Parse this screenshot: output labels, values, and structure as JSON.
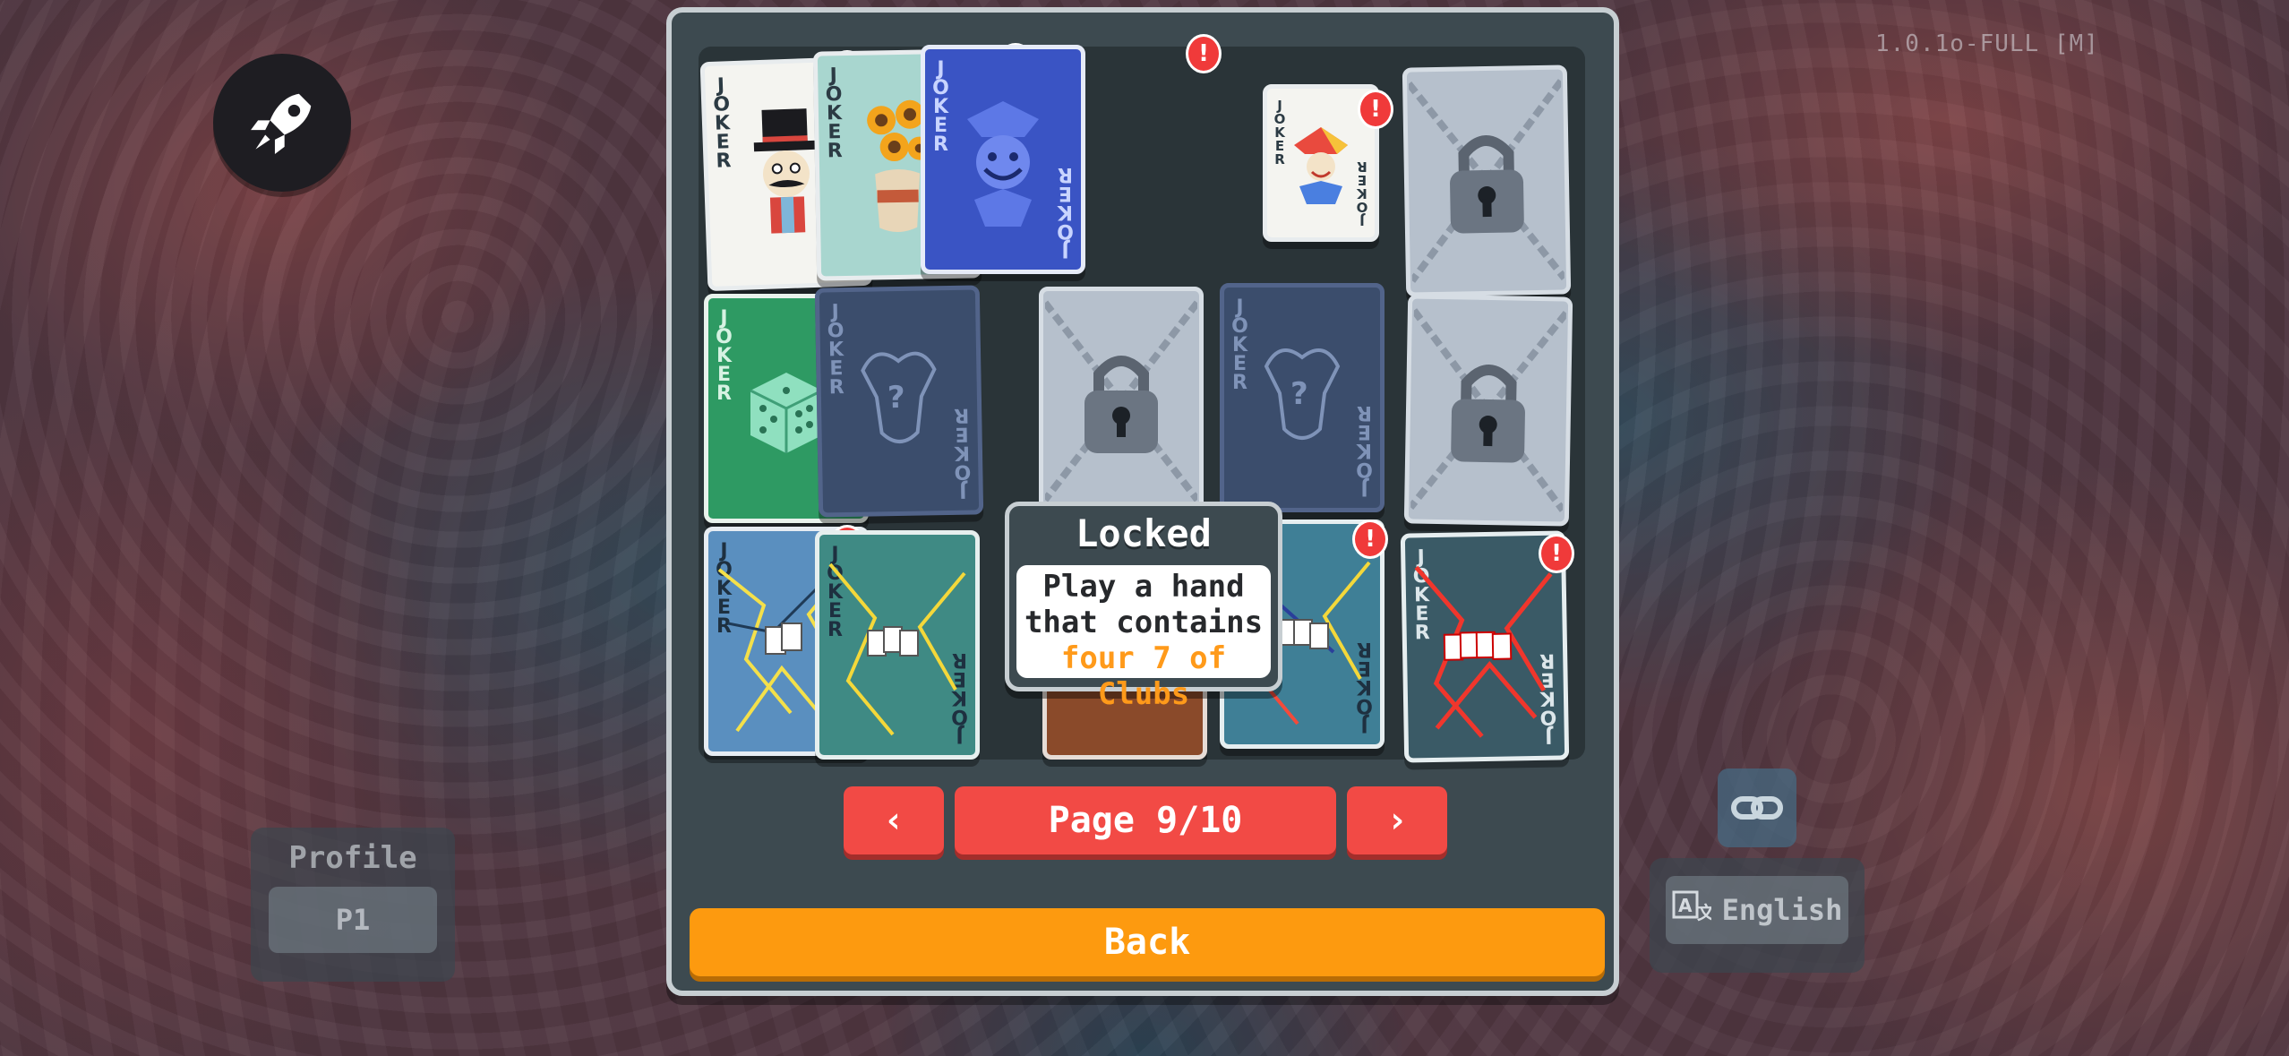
{
  "version": "1.0.1o-FULL [M]",
  "profile": {
    "label": "Profile",
    "value": "P1"
  },
  "language": {
    "label": "English",
    "icon": "translate-icon"
  },
  "tooltip": {
    "title": "Locked",
    "line1": "Play a hand",
    "line2": "that contains",
    "line3": "four 7 of Clubs"
  },
  "pagination": {
    "prev": "‹",
    "next": "›",
    "label": "Page 9/10"
  },
  "back_label": "Back",
  "card_text": "JOKER",
  "badge_text": "!",
  "cards": [
    {
      "name": "joker-top-hat-mustache",
      "state": "unlocked",
      "new": true
    },
    {
      "name": "joker-sunflowers-vase",
      "state": "unlocked",
      "new": true
    },
    {
      "name": "joker-blue-jester-face",
      "state": "unlocked",
      "new": true
    },
    {
      "name": "joker-small-jester",
      "state": "unlocked",
      "new": true
    },
    {
      "name": "joker-locked",
      "state": "locked",
      "new": false
    },
    {
      "name": "joker-green-dice",
      "state": "unlocked",
      "new": true
    },
    {
      "name": "joker-undiscovered",
      "state": "undiscovered",
      "new": false
    },
    {
      "name": "joker-locked",
      "state": "locked",
      "new": false
    },
    {
      "name": "joker-undiscovered",
      "state": "undiscovered",
      "new": false
    },
    {
      "name": "joker-locked",
      "state": "locked",
      "new": false
    },
    {
      "name": "joker-cracked-blue-yellow",
      "state": "unlocked",
      "new": true
    },
    {
      "name": "joker-cracked-green-yellow",
      "state": "unlocked",
      "new": true
    },
    {
      "name": "joker-hidden-by-tooltip",
      "state": "unlocked",
      "new": false
    },
    {
      "name": "joker-cracked-multicolor",
      "state": "unlocked",
      "new": true
    },
    {
      "name": "joker-cracked-red",
      "state": "unlocked",
      "new": true
    }
  ],
  "colors": {
    "accent_red": "#f24a45",
    "back_orange": "#fd9a0f",
    "highlight_orange": "#ff9a1a",
    "panel": "#3d4a50"
  }
}
